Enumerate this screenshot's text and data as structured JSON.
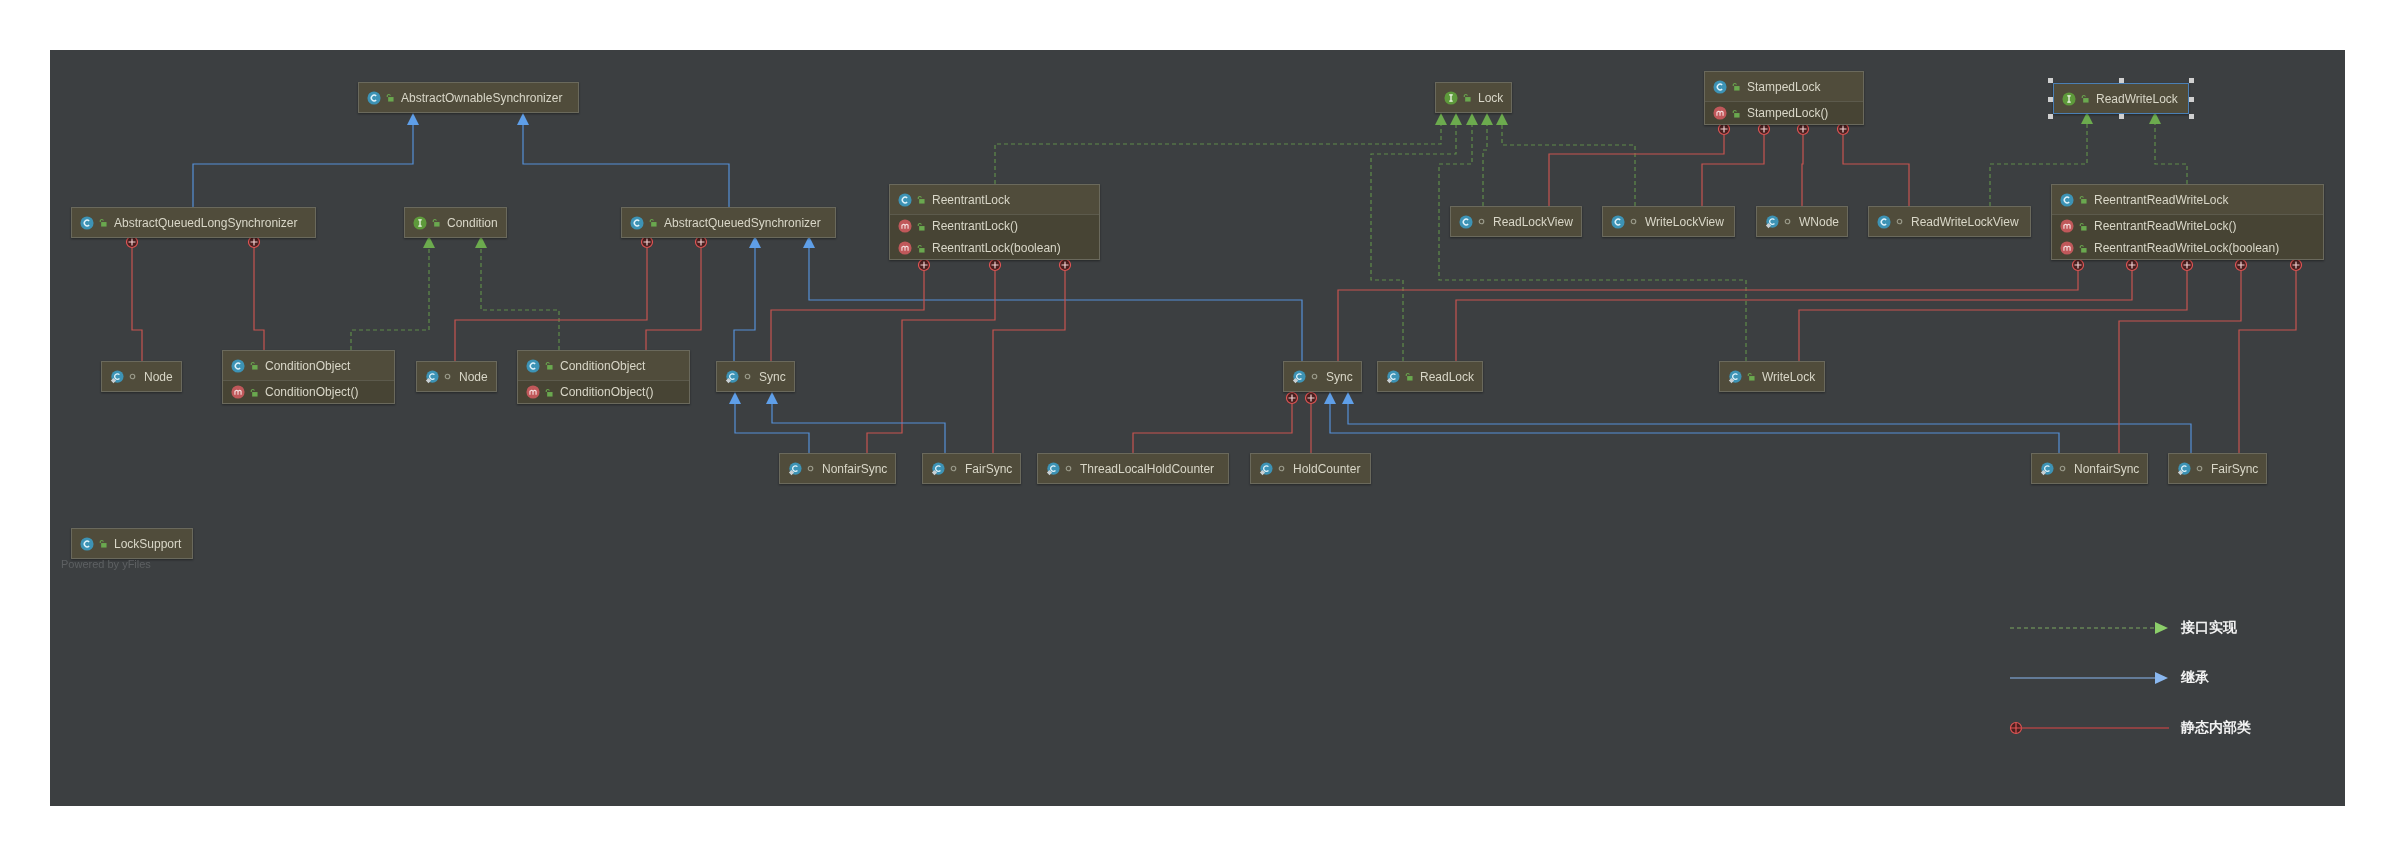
{
  "diagram": {
    "nodes": [
      {
        "kind": "class",
        "public": true,
        "name": "AbstractOwnableSynchronizer",
        "selected": false
      },
      {
        "kind": "class",
        "public": true,
        "name": "AbstractQueuedLongSynchronizer",
        "selected": false
      },
      {
        "kind": "interface",
        "public": true,
        "name": "Condition",
        "selected": false
      },
      {
        "kind": "class",
        "public": true,
        "name": "AbstractQueuedSynchronizer",
        "selected": false
      },
      {
        "kind": "inner",
        "public": false,
        "name": "Node",
        "selected": false
      },
      {
        "kind": "class",
        "public": true,
        "name": "ConditionObject",
        "selected": false,
        "methods": [
          {
            "public": true,
            "name": "ConditionObject()"
          }
        ]
      },
      {
        "kind": "inner",
        "public": false,
        "name": "Node",
        "selected": false
      },
      {
        "kind": "class",
        "public": true,
        "name": "ConditionObject",
        "selected": false,
        "methods": [
          {
            "public": true,
            "name": "ConditionObject()"
          }
        ]
      },
      {
        "kind": "inner",
        "public": false,
        "name": "Sync",
        "selected": false
      },
      {
        "kind": "class",
        "public": true,
        "name": "ReentrantLock",
        "selected": false,
        "methods": [
          {
            "public": true,
            "name": "ReentrantLock()"
          },
          {
            "public": true,
            "name": "ReentrantLock(boolean)"
          }
        ]
      },
      {
        "kind": "inner",
        "public": false,
        "name": "NonfairSync",
        "selected": false
      },
      {
        "kind": "inner",
        "public": false,
        "name": "FairSync",
        "selected": false
      },
      {
        "kind": "inner",
        "public": false,
        "name": "ThreadLocalHoldCounter",
        "selected": false
      },
      {
        "kind": "inner",
        "public": false,
        "name": "HoldCounter",
        "selected": false
      },
      {
        "kind": "inner",
        "public": false,
        "name": "Sync",
        "selected": false
      },
      {
        "kind": "inner",
        "public": true,
        "name": "ReadLock",
        "selected": false
      },
      {
        "kind": "interface",
        "public": true,
        "name": "Lock",
        "selected": false
      },
      {
        "kind": "class",
        "public": true,
        "name": "StampedLock",
        "selected": false,
        "methods": [
          {
            "public": true,
            "name": "StampedLock()"
          }
        ]
      },
      {
        "kind": "interface",
        "public": true,
        "name": "ReadWriteLock",
        "selected": true
      },
      {
        "kind": "class",
        "public": false,
        "name": "ReadLockView",
        "selected": false
      },
      {
        "kind": "class",
        "public": false,
        "name": "WriteLockView",
        "selected": false
      },
      {
        "kind": "inner",
        "public": false,
        "name": "WNode",
        "selected": false
      },
      {
        "kind": "class",
        "public": false,
        "name": "ReadWriteLockView",
        "selected": false
      },
      {
        "kind": "class",
        "public": true,
        "name": "ReentrantReadWriteLock",
        "selected": false,
        "methods": [
          {
            "public": true,
            "name": "ReentrantReadWriteLock()"
          },
          {
            "public": true,
            "name": "ReentrantReadWriteLock(boolean)"
          }
        ]
      },
      {
        "kind": "inner",
        "public": true,
        "name": "WriteLock",
        "selected": false
      },
      {
        "kind": "inner",
        "public": false,
        "name": "NonfairSync",
        "selected": false
      },
      {
        "kind": "inner",
        "public": false,
        "name": "FairSync",
        "selected": false
      },
      {
        "kind": "class",
        "public": true,
        "name": "LockSupport",
        "selected": false
      }
    ],
    "edges": [
      {
        "kind": "extends"
      },
      {
        "kind": "extends"
      },
      {
        "kind": "implements"
      },
      {
        "kind": "implements"
      },
      {
        "kind": "inner"
      },
      {
        "kind": "inner"
      },
      {
        "kind": "inner"
      },
      {
        "kind": "inner"
      },
      {
        "kind": "extends"
      },
      {
        "kind": "extends"
      },
      {
        "kind": "implements"
      },
      {
        "kind": "inner"
      },
      {
        "kind": "inner"
      },
      {
        "kind": "inner"
      },
      {
        "kind": "extends"
      },
      {
        "kind": "extends"
      },
      {
        "kind": "inner"
      },
      {
        "kind": "inner"
      },
      {
        "kind": "extends"
      },
      {
        "kind": "extends"
      },
      {
        "kind": "implements"
      },
      {
        "kind": "implements"
      },
      {
        "kind": "implements"
      },
      {
        "kind": "implements"
      },
      {
        "kind": "inner"
      },
      {
        "kind": "inner"
      },
      {
        "kind": "inner"
      },
      {
        "kind": "inner"
      },
      {
        "kind": "implements"
      },
      {
        "kind": "implements"
      },
      {
        "kind": "inner"
      },
      {
        "kind": "inner"
      },
      {
        "kind": "inner"
      },
      {
        "kind": "inner"
      },
      {
        "kind": "inner"
      }
    ],
    "footer_note": "Powered by yFiles"
  },
  "legend": [
    {
      "kind": "implements",
      "label": "接口实现"
    },
    {
      "kind": "extends",
      "label": "继承"
    },
    {
      "kind": "inner",
      "label": "静态内部类"
    }
  ]
}
